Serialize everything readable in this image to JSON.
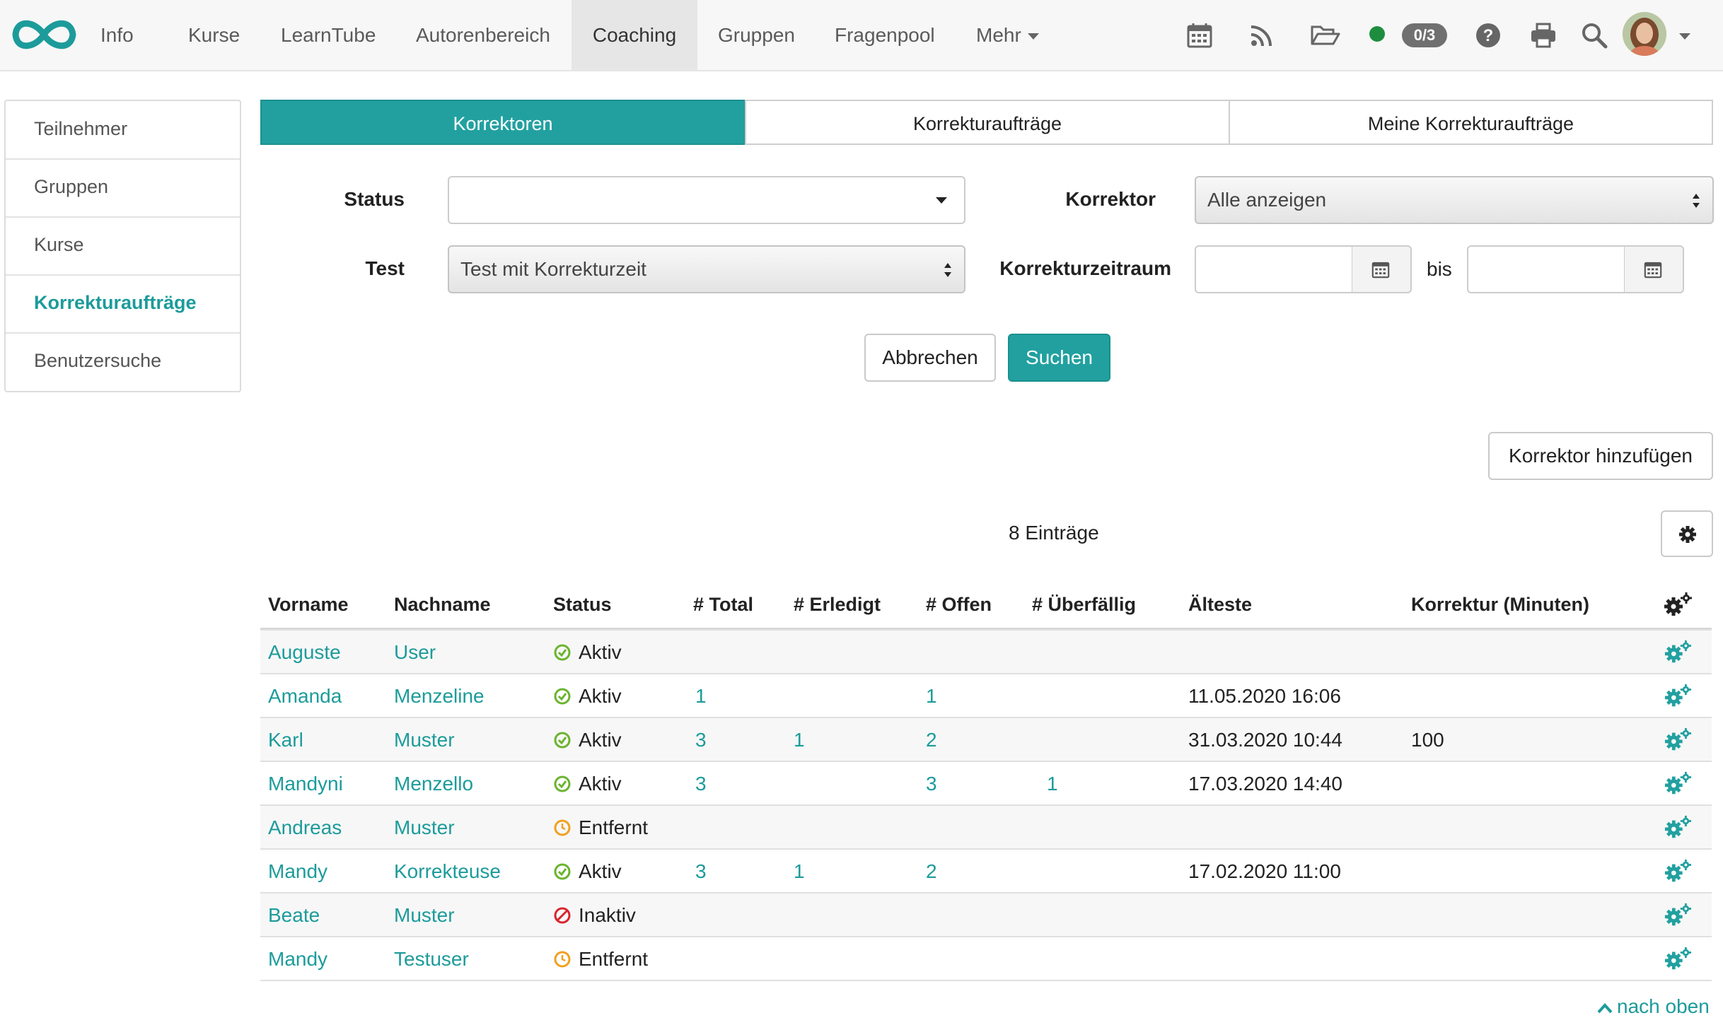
{
  "nav": {
    "items": [
      "Info",
      "Kurse",
      "LearnTube",
      "Autorenbereich",
      "Coaching",
      "Gruppen",
      "Fragenpool",
      "Mehr"
    ],
    "active": "Coaching",
    "badge": "0/3",
    "icons": [
      "calendar-icon",
      "rss-icon",
      "folder-open-icon",
      "status-dot",
      "help-icon",
      "print-icon",
      "search-icon",
      "user-avatar"
    ]
  },
  "sidebar": {
    "items": [
      "Teilnehmer",
      "Gruppen",
      "Kurse",
      "Korrekturaufträge",
      "Benutzersuche"
    ],
    "active": "Korrekturaufträge"
  },
  "tabs": [
    "Korrektoren",
    "Korrekturaufträge",
    "Meine Korrekturaufträge"
  ],
  "filters": {
    "status_label": "Status",
    "status_value": "",
    "korrektor_label": "Korrektor",
    "korrektor_value": "Alle anzeigen",
    "test_label": "Test",
    "test_value": "Test mit Korrekturzeit",
    "zeitraum_label": "Korrekturzeitraum",
    "bis_label": "bis",
    "cancel_label": "Abbrechen",
    "search_label": "Suchen"
  },
  "add_corrector_label": "Korrektor hinzufügen",
  "entries_count": "8 Einträge",
  "table": {
    "headers": [
      "Vorname",
      "Nachname",
      "Status",
      "# Total",
      "# Erledigt",
      "# Offen",
      "# Überfällig",
      "Älteste",
      "Korrektur (Minuten)"
    ],
    "rows": [
      [
        "Auguste",
        "User",
        "Aktiv",
        "",
        "",
        "",
        "",
        "",
        ""
      ],
      [
        "Amanda",
        "Menzeline",
        "Aktiv",
        "1",
        "",
        "1",
        "",
        "11.05.2020 16:06",
        ""
      ],
      [
        "Karl",
        "Muster",
        "Aktiv",
        "3",
        "1",
        "2",
        "",
        "31.03.2020 10:44",
        "100"
      ],
      [
        "Mandyni",
        "Menzello",
        "Aktiv",
        "3",
        "",
        "3",
        "1",
        "17.03.2020 14:40",
        ""
      ],
      [
        "Andreas",
        "Muster",
        "Entfernt",
        "",
        "",
        "",
        "",
        "",
        ""
      ],
      [
        "Mandy",
        "Korrekteuse",
        "Aktiv",
        "3",
        "1",
        "2",
        "",
        "17.02.2020 11:00",
        ""
      ],
      [
        "Beate",
        "Muster",
        "Inaktiv",
        "",
        "",
        "",
        "",
        "",
        ""
      ],
      [
        "Mandy",
        "Testuser",
        "Entfernt",
        "",
        "",
        "",
        "",
        "",
        ""
      ]
    ]
  },
  "back_to_top": "nach oben",
  "colors": {
    "accent": "#22a0a0",
    "link": "#1d9b9b",
    "status_active": "#6ab42d",
    "status_removed": "#f0a020",
    "status_inactive": "#d9232d"
  }
}
